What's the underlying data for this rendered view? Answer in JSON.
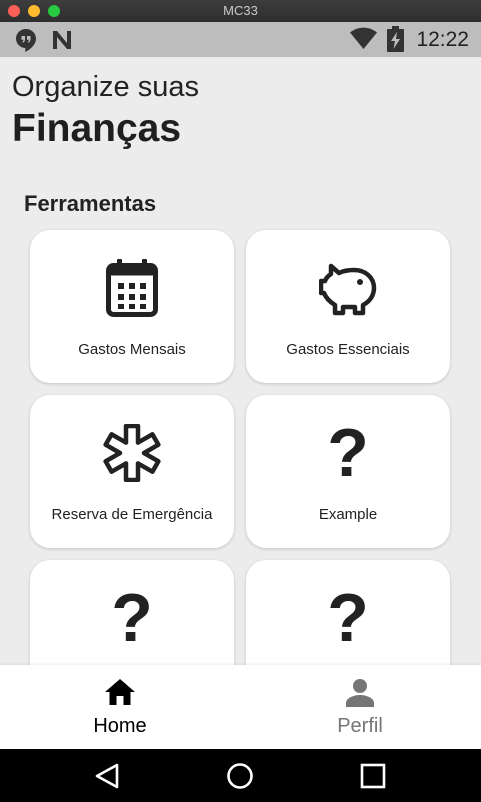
{
  "window": {
    "title": "MC33"
  },
  "status_bar": {
    "time": "12:22",
    "icons": [
      "hangouts-icon",
      "n-app-icon",
      "wifi-icon",
      "battery-charging-icon"
    ]
  },
  "header": {
    "subtitle": "Organize suas",
    "title": "Finanças"
  },
  "section": {
    "title": "Ferramentas"
  },
  "cards": [
    {
      "label": "Gastos Mensais",
      "icon": "calendar-icon"
    },
    {
      "label": "Gastos Essenciais",
      "icon": "piggy-bank-icon"
    },
    {
      "label": "Reserva de Emergência",
      "icon": "medical-star-icon"
    },
    {
      "label": "Example",
      "icon": "question-mark-icon",
      "glyph": "?"
    },
    {
      "label": "",
      "icon": "question-mark-icon",
      "glyph": "?"
    },
    {
      "label": "",
      "icon": "question-mark-icon",
      "glyph": "?"
    }
  ],
  "bottom_nav": {
    "items": [
      {
        "label": "Home",
        "icon": "home-icon",
        "active": true,
        "color": "#000000"
      },
      {
        "label": "Perfil",
        "icon": "person-icon",
        "active": false,
        "color": "#757575"
      }
    ]
  },
  "system_nav": [
    "back-icon",
    "home-circle-icon",
    "recents-icon"
  ]
}
